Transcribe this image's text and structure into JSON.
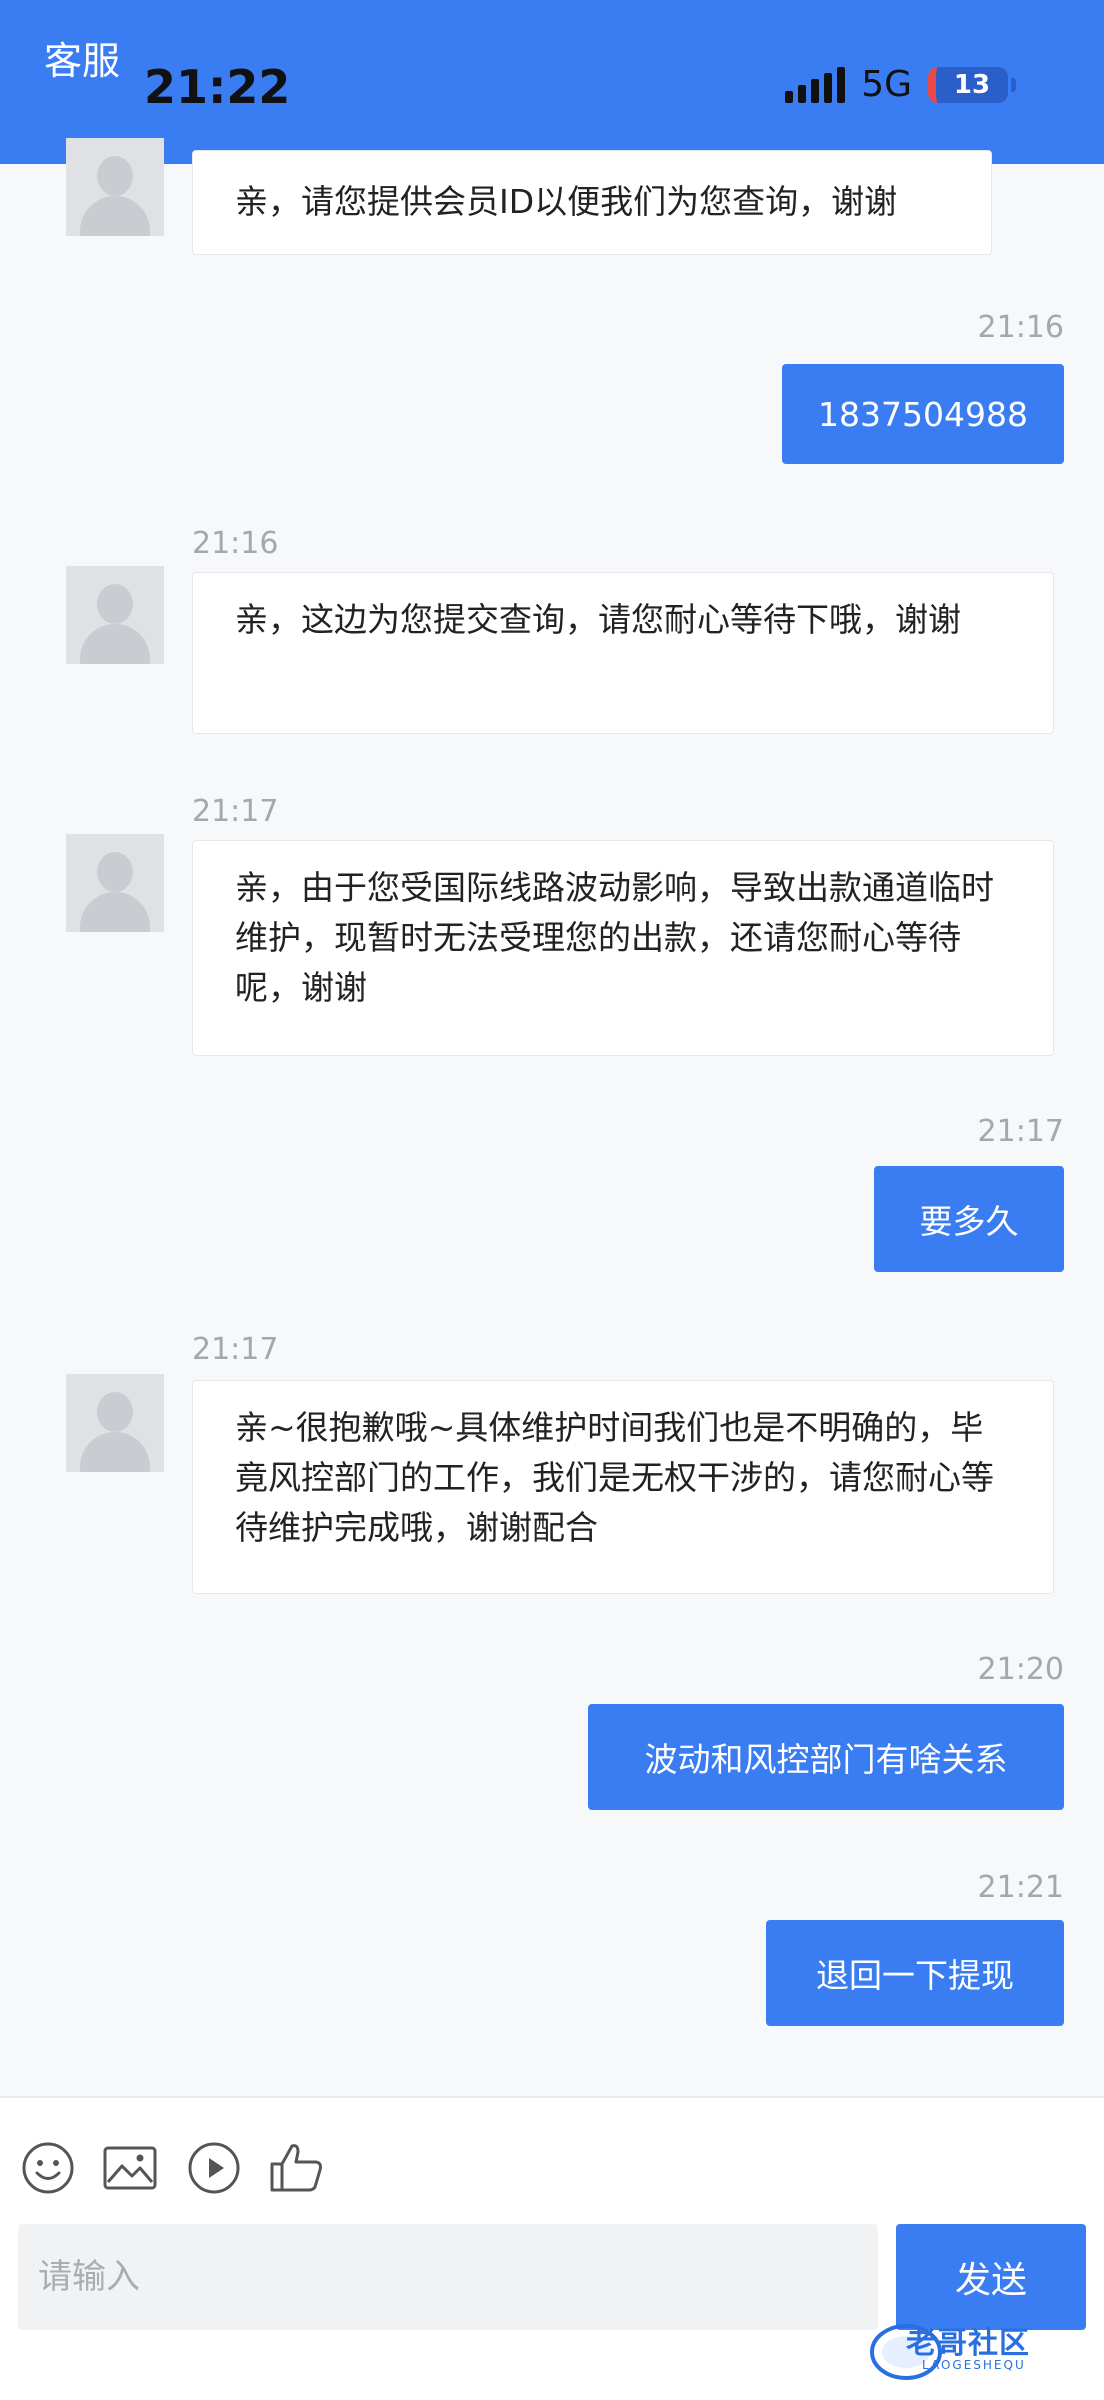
{
  "header": {
    "title": "客服",
    "clock": "21:22",
    "network": "5G",
    "battery": "13"
  },
  "messages": [
    {
      "side": "in",
      "text": "亲，请您提供会员ID以便我们为您查询，谢谢"
    },
    {
      "side": "out",
      "time": "21:16",
      "text": "1837504988"
    },
    {
      "side": "in",
      "time": "21:16",
      "text": "亲，这边为您提交查询，请您耐心等待下哦，谢谢"
    },
    {
      "side": "in",
      "time": "21:17",
      "text": "亲，由于您受国际线路波动影响，导致出款通道临时维护，现暂时无法受理您的出款，还请您耐心等待呢，谢谢"
    },
    {
      "side": "out",
      "time": "21:17",
      "text": "要多久"
    },
    {
      "side": "in",
      "time": "21:17",
      "text": "亲~很抱歉哦~具体维护时间我们也是不明确的，毕竟风控部门的工作，我们是无权干涉的，请您耐心等待维护完成哦，谢谢配合"
    },
    {
      "side": "out",
      "time": "21:20",
      "text": "波动和风控部门有啥关系"
    },
    {
      "side": "out",
      "time": "21:21",
      "text": "退回一下提现"
    }
  ],
  "composer": {
    "placeholder": "请输入",
    "send_label": "发送",
    "tools": [
      "emoji-icon",
      "image-icon",
      "play-icon",
      "thumbs-up-icon"
    ]
  },
  "watermark": {
    "text": "老哥社区",
    "sub": "LAOGESHEQU"
  },
  "colors": {
    "accent": "#3a7df2",
    "background": "#f7f8fa"
  }
}
